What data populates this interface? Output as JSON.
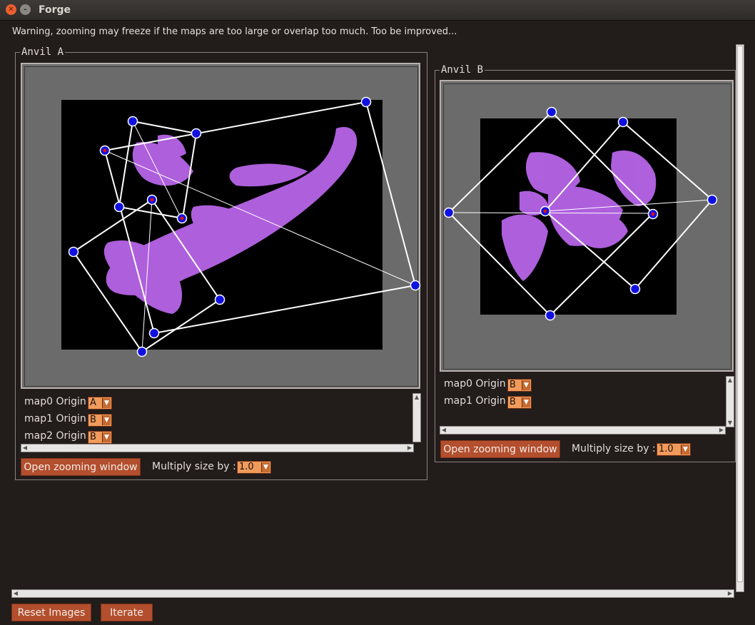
{
  "window": {
    "title": "Forge"
  },
  "warning": "Warning, zooming may freeze if the maps are too large or overlap too much. Too be improved...",
  "colors": {
    "background": "#221c1b",
    "button": "#b34f2e",
    "combo": "#f09a5c",
    "fractal": "#b865e8",
    "handle": "#1010e0"
  },
  "anvil_a": {
    "title": "Anvil A",
    "maps": [
      {
        "label": "map0 Origin",
        "value": "A"
      },
      {
        "label": "map1 Origin",
        "value": "B"
      },
      {
        "label": "map2 Origin",
        "value": "B"
      }
    ],
    "zoom_button": "Open zooming window",
    "multiply_label": "Multiply size by :",
    "multiply_value": "1.0"
  },
  "anvil_b": {
    "title": "Anvil B",
    "maps": [
      {
        "label": "map0 Origin",
        "value": "B"
      },
      {
        "label": "map1 Origin",
        "value": "B"
      }
    ],
    "zoom_button": "Open zooming window",
    "multiply_label": "Multiply size by :",
    "multiply_value": "1.0"
  },
  "footer": {
    "reset_button": "Reset Images",
    "iterate_button": "Iterate"
  }
}
